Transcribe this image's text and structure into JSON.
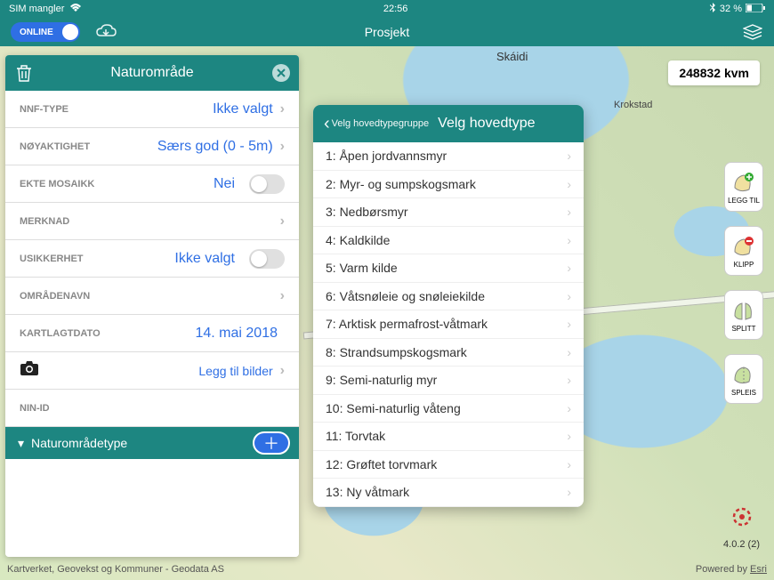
{
  "status": {
    "carrier": "SIM mangler",
    "time": "22:56",
    "battery": "32 %"
  },
  "topbar": {
    "online": "ONLINE",
    "title": "Prosjekt"
  },
  "area_badge": "248832 kvm",
  "right_tools": [
    {
      "label": "LEGG TIL"
    },
    {
      "label": "KLIPP"
    },
    {
      "label": "SPLITT"
    },
    {
      "label": "SPLEIS"
    }
  ],
  "gps": {},
  "version": "4.0.2 (2)",
  "attribution": "Kartverket, Geovekst og Kommuner - Geodata AS",
  "powered_by_prefix": "Powered by ",
  "powered_by_link": "Esri",
  "map_labels": {
    "skaidi": "Skáidi",
    "krokstad": "Krokstad"
  },
  "panel": {
    "title": "Naturområde",
    "rows": {
      "nnf_type": {
        "label": "NNF-TYPE",
        "value": "Ikke valgt"
      },
      "noyaktighet": {
        "label": "NØYAKTIGHET",
        "value": "Særs god (0 - 5m)"
      },
      "ekte_mosaikk": {
        "label": "EKTE MOSAIKK",
        "value": "Nei"
      },
      "merknad": {
        "label": "MERKNAD",
        "value": ""
      },
      "usikkerhet": {
        "label": "USIKKERHET",
        "value": "Ikke valgt"
      },
      "omradenavn": {
        "label": "OMRÅDENAVN",
        "value": ""
      },
      "kartlagtdato": {
        "label": "KARTLAGTDATO",
        "value": "14. mai 2018"
      },
      "legg_til_bilder": {
        "value": "Legg til bilder"
      },
      "nin_id": {
        "label": "NIN-ID",
        "value": ""
      }
    },
    "section": "Naturområdetype"
  },
  "picker": {
    "back": "Velg hovedtypegruppe",
    "title": "Velg hovedtype",
    "items": [
      "1: Åpen jordvannsmyr",
      "2: Myr- og sumpskogsmark",
      "3: Nedbørsmyr",
      "4: Kaldkilde",
      "5: Varm kilde",
      "6: Våtsnøleie og snøleiekilde",
      "7: Arktisk permafrost-våtmark",
      "8: Strandsumpskogsmark",
      "9: Semi-naturlig myr",
      "10: Semi-naturlig våteng",
      "11: Torvtak",
      "12: Grøftet torvmark",
      "13: Ny våtmark"
    ]
  }
}
